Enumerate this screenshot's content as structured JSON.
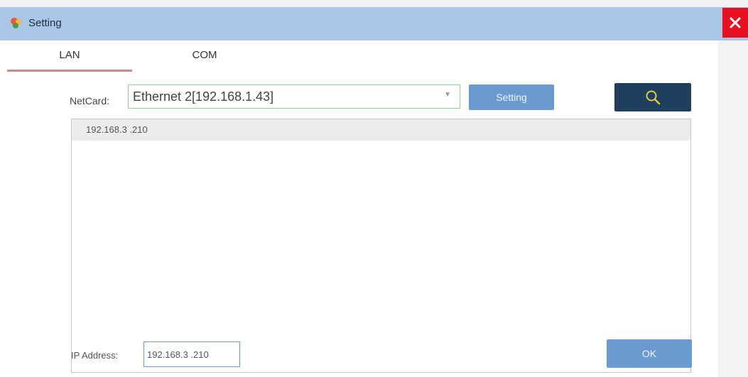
{
  "window": {
    "title": "Setting",
    "icon": "app-icon",
    "close_icon": "close-icon",
    "title_bar_color": "#a9c6e6",
    "close_color": "#e81123"
  },
  "tabs": [
    {
      "label": "LAN",
      "active": true
    },
    {
      "label": "COM",
      "active": false
    }
  ],
  "netcard": {
    "label": "NetCard:",
    "value": "Ethernet 2[192.168.1.43]",
    "arrow_icon": "chevron-down-icon"
  },
  "buttons": {
    "setting_label": "Setting",
    "search_icon": "search-icon",
    "ok_label": "OK",
    "accent_color": "#6a9ad0",
    "search_bg": "#1f3f5e"
  },
  "device_list": {
    "rows": [
      "192.168.3 .210"
    ]
  },
  "ip_address": {
    "label": "IP Address:",
    "value": "192.168.3 .210"
  }
}
